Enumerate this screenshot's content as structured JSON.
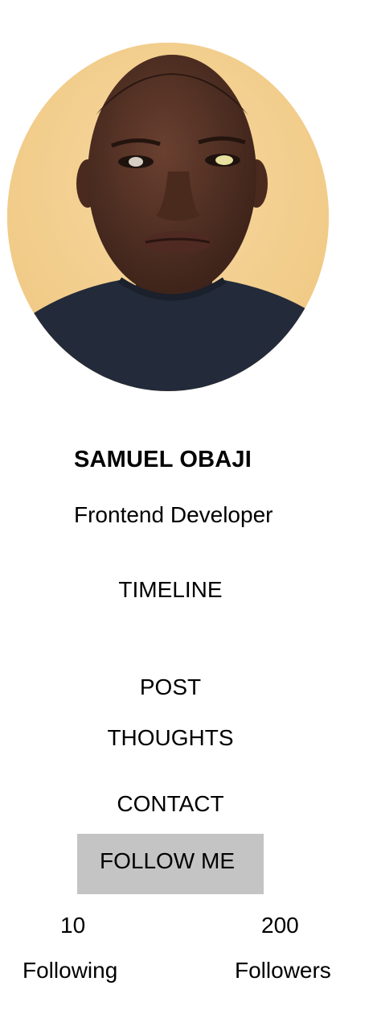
{
  "profile": {
    "name": "SAMUEL OBAJI",
    "role": "Frontend Developer"
  },
  "nav": {
    "items": [
      {
        "label": "TIMELINE"
      },
      {
        "label": "POST"
      },
      {
        "label": "THOUGHTS"
      },
      {
        "label": "CONTACT"
      }
    ]
  },
  "follow_button": {
    "label": "FOLLOW ME"
  },
  "stats": {
    "following": {
      "count": "10",
      "label": "Following"
    },
    "followers": {
      "count": "200",
      "label": "Followers"
    }
  },
  "colors": {
    "background": "#ffffff",
    "button_bg": "#c4c4c4",
    "text": "#000000",
    "photo_wall": "#f4cf8e",
    "shirt": "#232a3a"
  }
}
